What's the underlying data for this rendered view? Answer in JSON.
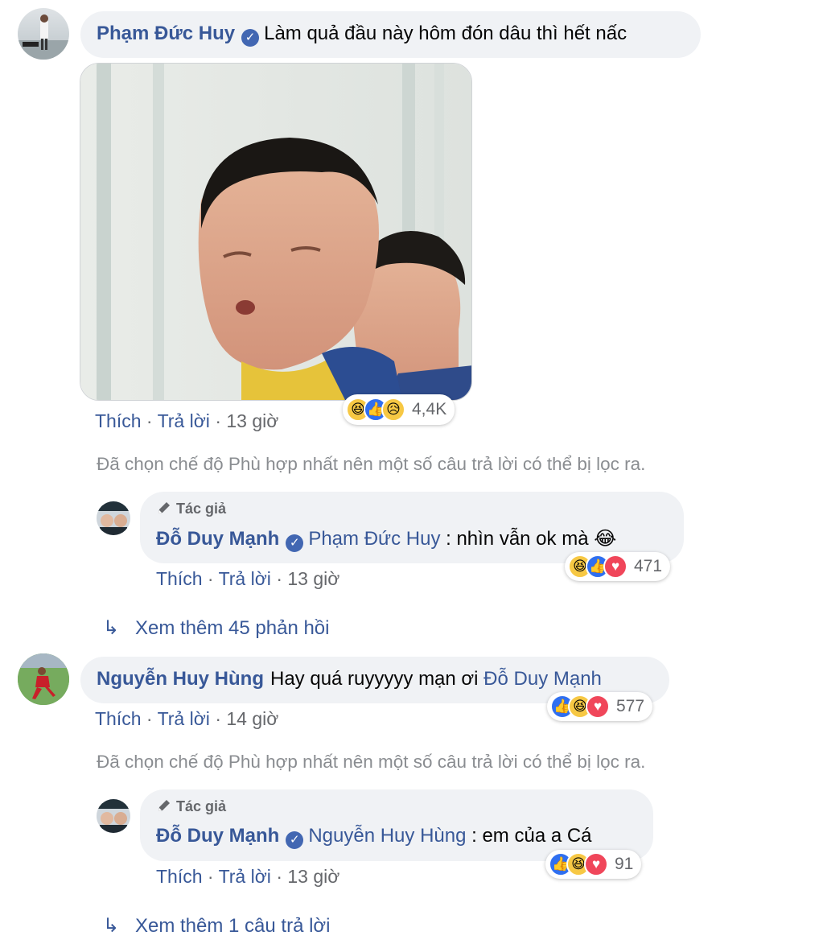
{
  "comments": [
    {
      "author": "Phạm Đức Huy",
      "text": "Làm quả đầu này hôm đón dâu thì hết nấc",
      "actions": {
        "like": "Thích",
        "reply": "Trả lời",
        "sep": "·",
        "time": "13 giờ"
      },
      "reaction_count": "4,4K",
      "reaction_icons": [
        "haha-icon",
        "like-icon",
        "sad-icon"
      ],
      "filter_notice": "Đã chọn chế độ Phù hợp nhất nên một số câu trả lời có thể bị lọc ra.",
      "reply": {
        "badge": "Tác giả",
        "author": "Đỗ Duy Mạnh",
        "mention": "Phạm Đức Huy",
        "text": " : nhìn vẫn ok mà 😂",
        "actions": {
          "like": "Thích",
          "reply": "Trả lời",
          "sep": "·",
          "time": "13 giờ"
        },
        "reaction_count": "471",
        "reaction_icons": [
          "haha-icon",
          "like-icon",
          "love-icon"
        ]
      },
      "more_replies": "Xem thêm 45 phản hồi"
    },
    {
      "author": "Nguyễn Huy Hùng",
      "text": "Hay quá ruyyyyy mạn ơi ",
      "mention": "Đỗ Duy Mạnh",
      "actions": {
        "like": "Thích",
        "reply": "Trả lời",
        "sep": "·",
        "time": "14 giờ"
      },
      "reaction_count": "577",
      "reaction_icons": [
        "like-icon",
        "haha-icon",
        "love-icon"
      ],
      "filter_notice": "Đã chọn chế độ Phù hợp nhất nên một số câu trả lời có thể bị lọc ra.",
      "reply": {
        "badge": "Tác giả",
        "author": "Đỗ Duy Mạnh",
        "mention": "Nguyễn Huy Hùng",
        "text": " : em của a Cá",
        "actions": {
          "like": "Thích",
          "reply": "Trả lời",
          "sep": "·",
          "time": "13 giờ"
        },
        "reaction_count": "91",
        "reaction_icons": [
          "like-icon",
          "haha-icon",
          "love-icon"
        ]
      },
      "more_replies": "Xem thêm 1 câu trả lời"
    }
  ],
  "colors": {
    "link": "#385898",
    "meta": "#65676b",
    "bubble": "#f0f2f5",
    "verified": "#4267b2"
  }
}
